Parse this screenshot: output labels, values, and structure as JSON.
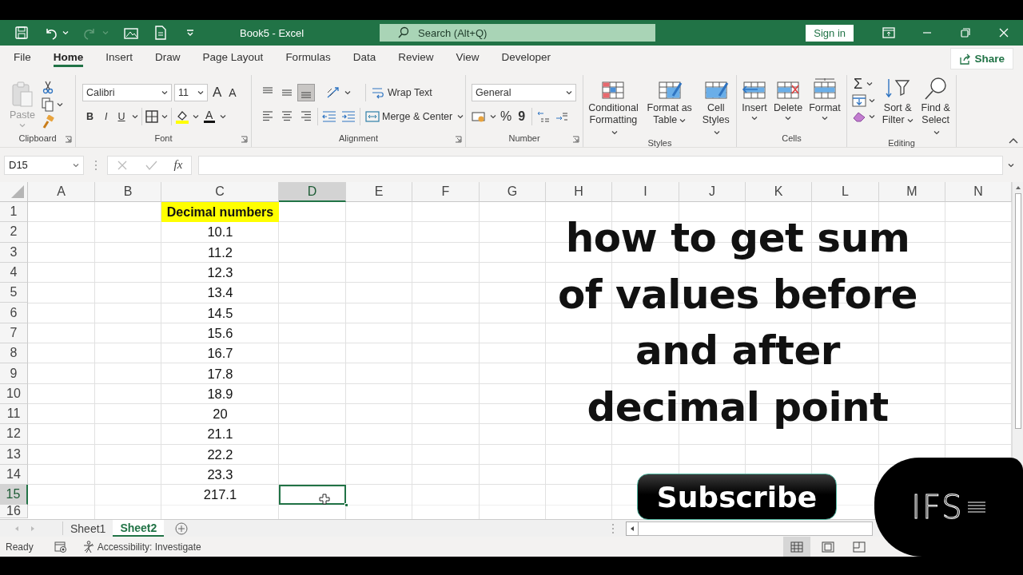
{
  "title_bar": {
    "document_title": "Book5  -  Excel",
    "search_placeholder": "Search (Alt+Q)",
    "sign_in": "Sign in"
  },
  "menu_tabs": [
    {
      "label": "File",
      "selected": false
    },
    {
      "label": "Home",
      "selected": true
    },
    {
      "label": "Insert",
      "selected": false
    },
    {
      "label": "Draw",
      "selected": false
    },
    {
      "label": "Page Layout",
      "selected": false
    },
    {
      "label": "Formulas",
      "selected": false
    },
    {
      "label": "Data",
      "selected": false
    },
    {
      "label": "Review",
      "selected": false
    },
    {
      "label": "View",
      "selected": false
    },
    {
      "label": "Developer",
      "selected": false
    }
  ],
  "share": "Share",
  "ribbon": {
    "clipboard": {
      "paste": "Paste",
      "label": "Clipboard"
    },
    "font": {
      "font_name": "Calibri",
      "font_size": "11",
      "grow": "A",
      "shrink": "A",
      "bold": "B",
      "italic": "I",
      "underline": "U",
      "font_color": "A",
      "label": "Font"
    },
    "alignment": {
      "vertical_align": [
        {
          "kind": "top",
          "selected": false
        },
        {
          "kind": "middle",
          "selected": false
        },
        {
          "kind": "bottom",
          "selected": true
        }
      ],
      "wrap_text": "Wrap Text",
      "merge_center": "Merge & Center",
      "label": "Alignment"
    },
    "number": {
      "format": "General",
      "percent": "%",
      "comma": "9",
      "label": "Number"
    },
    "styles": {
      "buttons": [
        "Conditional Formatting",
        "Format as Table",
        "Cell Styles"
      ],
      "label": "Styles"
    },
    "cells": {
      "buttons": [
        "Insert",
        "Delete",
        "Format"
      ],
      "label": "Cells"
    },
    "editing": {
      "sum": "Σ",
      "buttons": [
        "Sort & Filter",
        "Find & Select"
      ],
      "label": "Editing"
    }
  },
  "formula_bar": {
    "name_box": "D15",
    "fx": "fx"
  },
  "sheet": {
    "columns": [
      {
        "label": "A",
        "selected": false
      },
      {
        "label": "B",
        "selected": false
      },
      {
        "label": "C",
        "selected": false
      },
      {
        "label": "D",
        "selected": true
      },
      {
        "label": "E",
        "selected": false
      },
      {
        "label": "F",
        "selected": false
      },
      {
        "label": "G",
        "selected": false
      },
      {
        "label": "H",
        "selected": false
      },
      {
        "label": "I",
        "selected": false
      },
      {
        "label": "J",
        "selected": false
      },
      {
        "label": "K",
        "selected": false
      },
      {
        "label": "L",
        "selected": false
      },
      {
        "label": "M",
        "selected": false
      },
      {
        "label": "N",
        "selected": false
      }
    ],
    "rows": [
      {
        "number": "1",
        "selected": false,
        "column_c": "Decimal numbers",
        "kind": "highlight"
      },
      {
        "number": "2",
        "selected": false,
        "column_c": "10.1",
        "kind": "value"
      },
      {
        "number": "3",
        "selected": false,
        "column_c": "11.2",
        "kind": "value"
      },
      {
        "number": "4",
        "selected": false,
        "column_c": "12.3",
        "kind": "value"
      },
      {
        "number": "5",
        "selected": false,
        "column_c": "13.4",
        "kind": "value"
      },
      {
        "number": "6",
        "selected": false,
        "column_c": "14.5",
        "kind": "value"
      },
      {
        "number": "7",
        "selected": false,
        "column_c": "15.6",
        "kind": "value"
      },
      {
        "number": "8",
        "selected": false,
        "column_c": "16.7",
        "kind": "value"
      },
      {
        "number": "9",
        "selected": false,
        "column_c": "17.8",
        "kind": "value"
      },
      {
        "number": "10",
        "selected": false,
        "column_c": "18.9",
        "kind": "value"
      },
      {
        "number": "11",
        "selected": false,
        "column_c": "20",
        "kind": "value"
      },
      {
        "number": "12",
        "selected": false,
        "column_c": "21.1",
        "kind": "value"
      },
      {
        "number": "13",
        "selected": false,
        "column_c": "22.2",
        "kind": "value"
      },
      {
        "number": "14",
        "selected": false,
        "column_c": "23.3",
        "kind": "value"
      },
      {
        "number": "15",
        "selected": true,
        "column_c": "217.1",
        "kind": "value"
      },
      {
        "number": "16",
        "selected": false
      }
    ]
  },
  "sheet_tabs": [
    {
      "label": "Sheet1",
      "selected": false
    },
    {
      "label": "Sheet2",
      "selected": true
    }
  ],
  "status_bar": {
    "status": "Ready",
    "accessibility": "Accessibility: Investigate",
    "view_buttons": [
      {
        "kind": "normal",
        "selected": true
      },
      {
        "kind": "page_layout",
        "selected": false
      },
      {
        "kind": "page_break",
        "selected": false
      }
    ]
  },
  "overlay": {
    "headline": "how to get sum of values before and after decimal point",
    "subscribe": "Subscribe",
    "logo": "IFS"
  }
}
